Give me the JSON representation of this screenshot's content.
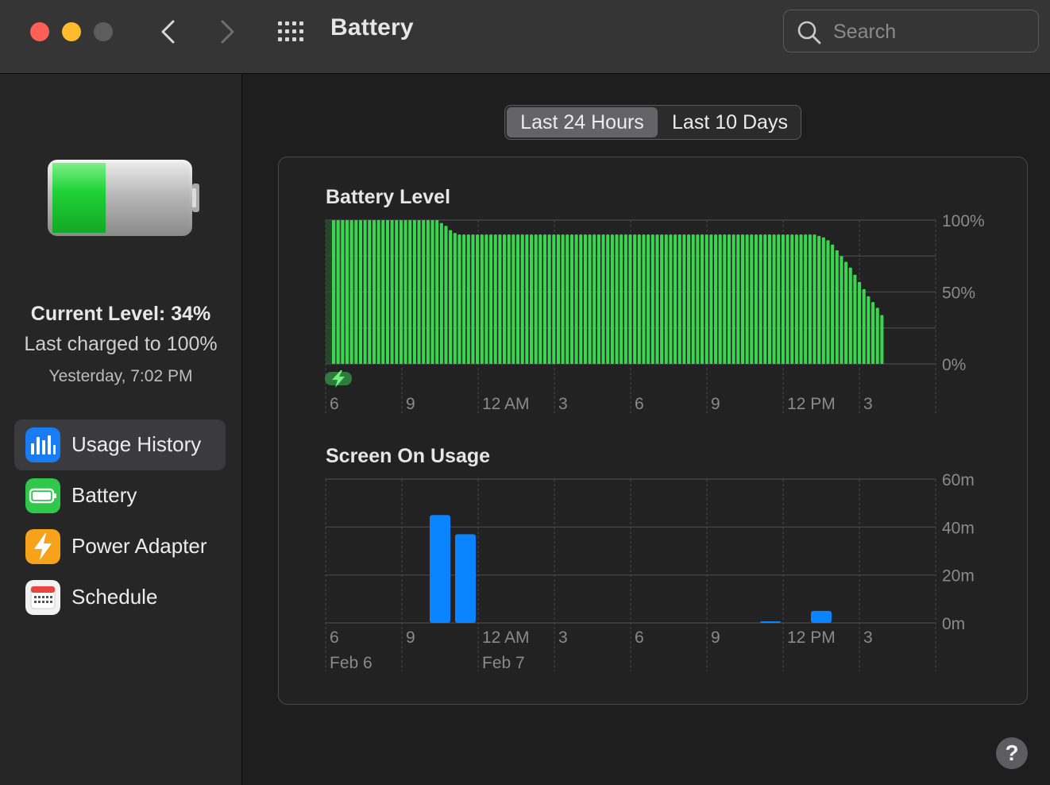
{
  "window": {
    "title": "Battery",
    "search_placeholder": "Search"
  },
  "sidebar": {
    "current_level": "Current Level: 34%",
    "last_charged": "Last charged to 100%",
    "charged_time": "Yesterday, 7:02 PM",
    "battery_fill_percent": 34,
    "items": [
      {
        "label": "Usage History",
        "icon": "usage-history-icon",
        "color": "#1a7cf5",
        "selected": true
      },
      {
        "label": "Battery",
        "icon": "battery-icon",
        "color": "#2fc84a",
        "selected": false
      },
      {
        "label": "Power Adapter",
        "icon": "power-adapter-icon",
        "color": "#f7a21b",
        "selected": false
      },
      {
        "label": "Schedule",
        "icon": "calendar-icon",
        "color": "#f2f2f2",
        "selected": false
      }
    ]
  },
  "range_selector": {
    "options": [
      "Last 24 Hours",
      "Last 10 Days"
    ],
    "selected": "Last 24 Hours"
  },
  "colors": {
    "battery_bar": "#3ad64f",
    "usage_bar": "#0a84ff",
    "grid": "#4a4a4a",
    "axis_text": "#8a8a8a"
  },
  "chart_data": [
    {
      "type": "bar",
      "title": "Battery Level",
      "y_tick_labels": [
        "100%",
        "50%",
        "0%"
      ],
      "ylim": [
        0,
        100
      ],
      "x_tick_labels": [
        "6",
        "9",
        "12 AM",
        "3",
        "6",
        "9",
        "12 PM",
        "3"
      ],
      "charging_segment": "6 PM – 7:02 PM",
      "values": [
        100,
        100,
        100,
        100,
        100,
        100,
        100,
        100,
        100,
        100,
        100,
        100,
        100,
        100,
        100,
        100,
        100,
        100,
        100,
        100,
        100,
        100,
        100,
        100,
        98,
        96,
        93,
        91,
        90,
        90,
        90,
        90,
        90,
        90,
        90,
        90,
        90,
        90,
        90,
        90,
        90,
        90,
        90,
        90,
        90,
        90,
        90,
        90,
        90,
        90,
        90,
        90,
        90,
        90,
        90,
        90,
        90,
        90,
        90,
        90,
        90,
        90,
        90,
        90,
        90,
        90,
        90,
        90,
        90,
        90,
        90,
        90,
        90,
        90,
        90,
        90,
        90,
        90,
        90,
        90,
        90,
        90,
        90,
        90,
        90,
        90,
        90,
        90,
        90,
        90,
        90,
        90,
        90,
        90,
        90,
        90,
        90,
        90,
        90,
        90,
        90,
        90,
        90,
        90,
        90,
        90,
        90,
        90,
        89,
        88,
        86,
        83,
        79,
        75,
        71,
        67,
        62,
        57,
        52,
        47,
        43,
        39,
        34
      ]
    },
    {
      "type": "bar",
      "title": "Screen On Usage",
      "y_tick_labels": [
        "60m",
        "40m",
        "20m",
        "0m"
      ],
      "ylim": [
        0,
        60
      ],
      "x_tick_labels": [
        "6",
        "9",
        "12 AM",
        "3",
        "6",
        "9",
        "12 PM",
        "3"
      ],
      "date_labels": [
        "Feb 6",
        "Feb 7"
      ],
      "bars": [
        {
          "hour": "10 PM",
          "minutes": 45
        },
        {
          "hour": "11 PM",
          "minutes": 37
        },
        {
          "hour": "11 AM",
          "minutes": 0.5
        },
        {
          "hour": "1 PM",
          "minutes": 5
        }
      ]
    }
  ]
}
